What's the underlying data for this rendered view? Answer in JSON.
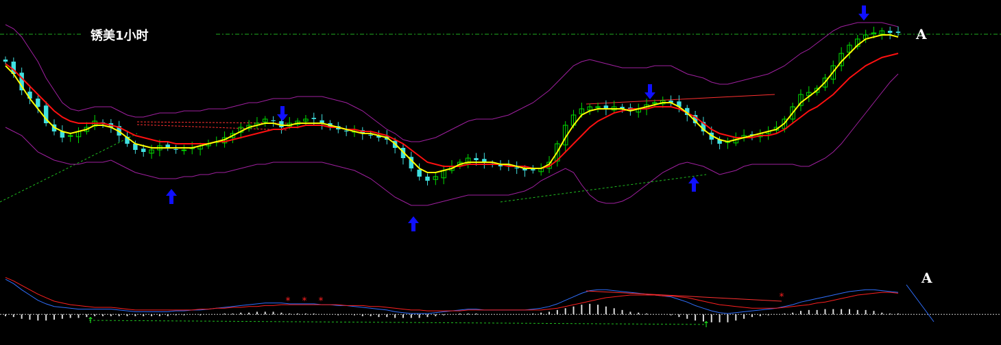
{
  "chart_data": {
    "type": "candlestick",
    "title": "锈美1小时",
    "marker_label": "A",
    "colors": {
      "background": "#000000",
      "up_candle": "#00e000",
      "down_candle": "#40e0e0",
      "fast_ma": "#ffff00",
      "slow_ma": "#ff1010",
      "bollinger": "#a020a0",
      "reference_line": "#20c020",
      "arrow_top": "#1010ff",
      "arrow_bottom": "#1010ff",
      "macd_dif": "#3070ff",
      "macd_dea": "#ff2020",
      "macd_hist": "#dddddd",
      "macd_zero": "#cccccc",
      "divergence_line": "#ff3030"
    },
    "price_chart": {
      "x_range": [
        0,
        100
      ],
      "y_range": [
        0,
        100
      ],
      "close": [
        80,
        74,
        66,
        62,
        58,
        50,
        46,
        43,
        44,
        46,
        48,
        51,
        50,
        48,
        44,
        40,
        37,
        36,
        37,
        39,
        38,
        37,
        37,
        38,
        39,
        40,
        41,
        43,
        45,
        48,
        49,
        50,
        52,
        51,
        48,
        50,
        51,
        52,
        52,
        50,
        48,
        47,
        46,
        46,
        45,
        44,
        43,
        42,
        38,
        33,
        28,
        24,
        22,
        24,
        27,
        29,
        31,
        33,
        32,
        31,
        30,
        29,
        29,
        28,
        27,
        27,
        28,
        31,
        40,
        49,
        54,
        57,
        58,
        58,
        57,
        58,
        57,
        56,
        57,
        59,
        60,
        61,
        60,
        58,
        54,
        50,
        46,
        42,
        40,
        41,
        43,
        44,
        44,
        45,
        46,
        48,
        52,
        58,
        64,
        65,
        67,
        72,
        78,
        84,
        88,
        91,
        93,
        94,
        95,
        94,
        94
      ],
      "ma_fast": [
        78,
        74,
        68,
        62,
        57,
        52,
        48,
        46,
        45,
        46,
        47,
        49,
        49,
        48,
        46,
        43,
        40,
        39,
        38,
        38,
        38,
        38,
        38,
        38,
        39,
        40,
        41,
        42,
        44,
        46,
        48,
        49,
        50,
        50,
        49,
        49,
        50,
        50,
        50,
        50,
        49,
        48,
        47,
        46,
        45,
        45,
        44,
        43,
        40,
        36,
        32,
        28,
        26,
        26,
        27,
        28,
        30,
        31,
        31,
        31,
        31,
        30,
        30,
        29,
        28,
        28,
        28,
        30,
        36,
        43,
        49,
        54,
        56,
        57,
        57,
        57,
        57,
        56,
        57,
        58,
        59,
        60,
        60,
        58,
        55,
        51,
        47,
        44,
        42,
        41,
        42,
        43,
        44,
        45,
        46,
        47,
        50,
        55,
        60,
        63,
        66,
        70,
        75,
        80,
        84,
        88,
        91,
        92,
        93,
        93,
        92
      ],
      "ma_slow": [
        79,
        76,
        72,
        68,
        64,
        60,
        56,
        53,
        51,
        50,
        50,
        50,
        50,
        49,
        48,
        46,
        44,
        43,
        42,
        41,
        41,
        40,
        40,
        40,
        40,
        40,
        41,
        41,
        42,
        43,
        44,
        45,
        46,
        47,
        47,
        48,
        48,
        49,
        49,
        49,
        48,
        48,
        47,
        47,
        46,
        46,
        45,
        44,
        42,
        40,
        37,
        34,
        31,
        30,
        29,
        29,
        29,
        30,
        30,
        30,
        30,
        30,
        29,
        29,
        29,
        28,
        28,
        29,
        32,
        36,
        40,
        44,
        48,
        51,
        53,
        55,
        56,
        57,
        57,
        57,
        58,
        58,
        58,
        57,
        55,
        53,
        50,
        47,
        45,
        44,
        43,
        43,
        43,
        44,
        44,
        45,
        47,
        50,
        53,
        56,
        58,
        61,
        64,
        68,
        72,
        75,
        78,
        80,
        82,
        83,
        84
      ],
      "bollinger_upper": [
        98,
        96,
        92,
        86,
        80,
        72,
        66,
        60,
        57,
        56,
        57,
        58,
        58,
        58,
        56,
        54,
        53,
        53,
        54,
        55,
        55,
        55,
        56,
        56,
        56,
        57,
        57,
        57,
        58,
        59,
        60,
        60,
        61,
        62,
        62,
        62,
        63,
        63,
        63,
        63,
        62,
        61,
        60,
        58,
        56,
        53,
        50,
        47,
        45,
        42,
        41,
        41,
        42,
        43,
        45,
        47,
        49,
        51,
        52,
        52,
        52,
        53,
        54,
        56,
        58,
        60,
        63,
        66,
        70,
        74,
        78,
        80,
        81,
        80,
        79,
        78,
        77,
        77,
        77,
        77,
        78,
        78,
        78,
        76,
        74,
        73,
        72,
        70,
        69,
        69,
        70,
        71,
        72,
        73,
        74,
        76,
        78,
        81,
        84,
        86,
        89,
        92,
        95,
        97,
        98,
        99,
        99,
        99,
        99,
        98,
        97
      ],
      "bollinger_lower": [
        48,
        46,
        44,
        40,
        36,
        34,
        32,
        31,
        30,
        30,
        31,
        31,
        31,
        32,
        30,
        28,
        26,
        25,
        24,
        23,
        23,
        23,
        24,
        24,
        25,
        25,
        26,
        26,
        27,
        28,
        29,
        30,
        30,
        31,
        31,
        31,
        31,
        31,
        31,
        31,
        30,
        29,
        28,
        27,
        25,
        23,
        20,
        17,
        14,
        12,
        10,
        10,
        10,
        11,
        12,
        13,
        14,
        15,
        15,
        15,
        15,
        15,
        15,
        16,
        17,
        19,
        22,
        24,
        26,
        28,
        26,
        20,
        15,
        12,
        11,
        11,
        12,
        14,
        17,
        20,
        23,
        26,
        28,
        30,
        31,
        30,
        29,
        27,
        25,
        26,
        27,
        29,
        30,
        30,
        30,
        30,
        30,
        30,
        29,
        29,
        31,
        33,
        36,
        40,
        45,
        50,
        55,
        60,
        65,
        70,
        74
      ]
    },
    "macd": {
      "dif": [
        40,
        35,
        28,
        22,
        16,
        12,
        9,
        8,
        7,
        6,
        6,
        6,
        6,
        6,
        5,
        4,
        3,
        3,
        3,
        3,
        3,
        4,
        4,
        5,
        5,
        6,
        7,
        8,
        9,
        10,
        11,
        12,
        13,
        13,
        13,
        12,
        12,
        12,
        12,
        11,
        11,
        10,
        10,
        9,
        8,
        7,
        6,
        5,
        3,
        2,
        1,
        1,
        1,
        2,
        3,
        4,
        5,
        6,
        6,
        5,
        5,
        5,
        5,
        5,
        5,
        6,
        7,
        9,
        12,
        16,
        20,
        24,
        27,
        28,
        28,
        27,
        26,
        25,
        24,
        23,
        22,
        21,
        20,
        17,
        14,
        10,
        7,
        4,
        2,
        1,
        2,
        3,
        4,
        5,
        6,
        7,
        9,
        11,
        14,
        16,
        18,
        20,
        22,
        24,
        26,
        27,
        28,
        28,
        27,
        26,
        25
      ],
      "dea": [
        42,
        38,
        33,
        28,
        23,
        19,
        15,
        13,
        11,
        10,
        9,
        8,
        8,
        8,
        7,
        6,
        5,
        5,
        5,
        5,
        5,
        5,
        5,
        5,
        6,
        6,
        7,
        7,
        8,
        8,
        9,
        9,
        10,
        10,
        11,
        11,
        11,
        11,
        11,
        11,
        11,
        11,
        10,
        10,
        10,
        9,
        9,
        8,
        7,
        6,
        5,
        5,
        4,
        4,
        4,
        4,
        4,
        5,
        5,
        5,
        5,
        5,
        5,
        5,
        5,
        5,
        5,
        6,
        7,
        9,
        11,
        13,
        15,
        17,
        19,
        20,
        21,
        22,
        22,
        22,
        22,
        21,
        21,
        20,
        19,
        17,
        15,
        13,
        11,
        10,
        9,
        8,
        7,
        7,
        7,
        7,
        8,
        9,
        10,
        11,
        13,
        14,
        16,
        18,
        20,
        22,
        23,
        24,
        25,
        25,
        24
      ],
      "histogram": [
        -2,
        -3,
        -5,
        -6,
        -7,
        -7,
        -6,
        -5,
        -4,
        -4,
        -3,
        -2,
        -2,
        -2,
        -2,
        -2,
        -2,
        -2,
        -2,
        -2,
        -2,
        -1,
        -1,
        0,
        -1,
        0,
        0,
        1,
        1,
        2,
        2,
        3,
        3,
        3,
        2,
        1,
        1,
        1,
        1,
        0,
        0,
        -1,
        0,
        -1,
        -2,
        -2,
        -3,
        -3,
        -4,
        -4,
        -4,
        -4,
        -3,
        -2,
        -1,
        0,
        1,
        1,
        1,
        0,
        0,
        0,
        0,
        0,
        0,
        1,
        2,
        3,
        5,
        7,
        9,
        11,
        12,
        11,
        9,
        7,
        5,
        3,
        2,
        1,
        0,
        0,
        -1,
        -3,
        -5,
        -7,
        -8,
        -9,
        -9,
        -9,
        -7,
        -5,
        -3,
        -2,
        -1,
        0,
        1,
        2,
        4,
        5,
        5,
        6,
        6,
        6,
        6,
        5,
        5,
        4,
        2,
        1,
        1
      ],
      "y_range": [
        -20,
        50
      ]
    }
  }
}
